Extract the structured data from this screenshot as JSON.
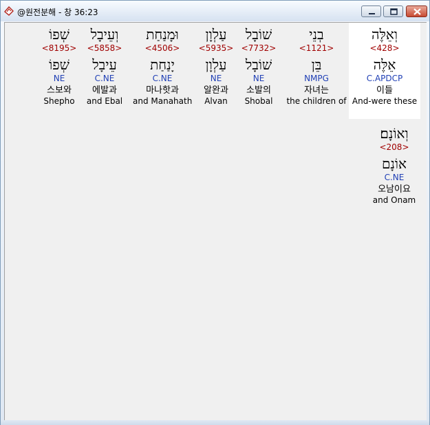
{
  "window": {
    "title": "@원전분해 - 창 36:23"
  },
  "words": [
    {
      "hebrew": "וְאֵלֶּה",
      "strong": "<428>",
      "lemma": "אֵלֶּה",
      "morph": "C.APDCP",
      "korean": "이들",
      "english": "And-were these",
      "highlight": true
    },
    {
      "hebrew": "בְנֵי",
      "strong": "<1121>",
      "lemma": "בֵּן",
      "morph": "NMPG",
      "korean": "자녀는",
      "english": "the children of",
      "highlight": false
    },
    {
      "hebrew": "שׁוֹבָל",
      "strong": "<7732>",
      "lemma": "שׁוֹבָל",
      "morph": "NE",
      "korean": "소발의",
      "english": "Shobal",
      "highlight": false
    },
    {
      "hebrew": "עַלְוָן",
      "strong": "<5935>",
      "lemma": "עַלְוָן",
      "morph": "NE",
      "korean": "알완과",
      "english": "Alvan",
      "highlight": false
    },
    {
      "hebrew": "וּמָנַחַת",
      "strong": "<4506>",
      "lemma": "יָנַחַת",
      "morph": "C.NE",
      "korean": "마나핫과",
      "english": "and Manahath",
      "highlight": false
    },
    {
      "hebrew": "וְעֵיבָל",
      "strong": "<5858>",
      "lemma": "עֵיבָל",
      "morph": "C.NE",
      "korean": "에발과",
      "english": "and Ebal",
      "highlight": false
    },
    {
      "hebrew": "שְׁפוֹ",
      "strong": "<8195>",
      "lemma": "שְׁפוֹ",
      "morph": "NE",
      "korean": "스보와",
      "english": "Shepho",
      "highlight": false
    },
    {
      "hebrew": "וְאוֹנָם׃",
      "strong": "<208>",
      "lemma": "אוֹנָם",
      "morph": "C.NE",
      "korean": "오남이요",
      "english": "and Onam",
      "highlight": false
    }
  ],
  "colors": {
    "strong": "#a00000",
    "morph": "#1f3fb5",
    "highlight": "#ffffff",
    "background": "#f0f0f0"
  },
  "icons": [
    "app-icon",
    "minimize-icon",
    "maximize-icon",
    "close-icon"
  ]
}
